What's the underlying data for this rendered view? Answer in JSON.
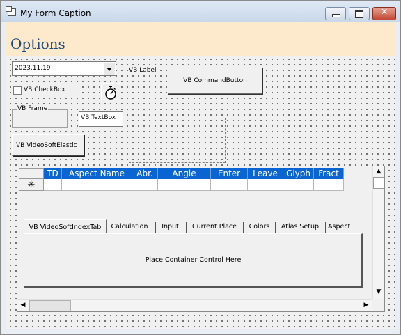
{
  "window": {
    "title": "My Form Caption",
    "close_glyph": "✕"
  },
  "banner": {
    "title": "Options",
    "color": "#fdeacc"
  },
  "combo": {
    "value": "2023.11.19"
  },
  "label": {
    "text": "VB Label"
  },
  "command_button": {
    "label": "VB CommandButton"
  },
  "checkbox": {
    "label": "VB CheckBox",
    "checked": false
  },
  "timer": {
    "icon": "stopwatch-icon"
  },
  "frame": {
    "caption": "VB Frame"
  },
  "textbox": {
    "value": "VB TextBox"
  },
  "elastic": {
    "label": "VB VideoSoftElastic"
  },
  "grid": {
    "accent": "#0a64d1",
    "columns": [
      "TD",
      "Aspect Name",
      "Abr.",
      "Angle",
      "Enter",
      "Leave",
      "Glyph",
      "Fract"
    ],
    "new_row_marker": "✳",
    "scroll_up": "▲",
    "scroll_down": "▼",
    "scroll_left": "◀",
    "scroll_right": "▶"
  },
  "tabs": {
    "items": [
      "VB VideoSoftIndexTab",
      "Calculation",
      "Input",
      "Current Place",
      "Colors",
      "Atlas Setup",
      "Aspect"
    ],
    "active": 0,
    "panel_text": "Place Container Control Here"
  }
}
